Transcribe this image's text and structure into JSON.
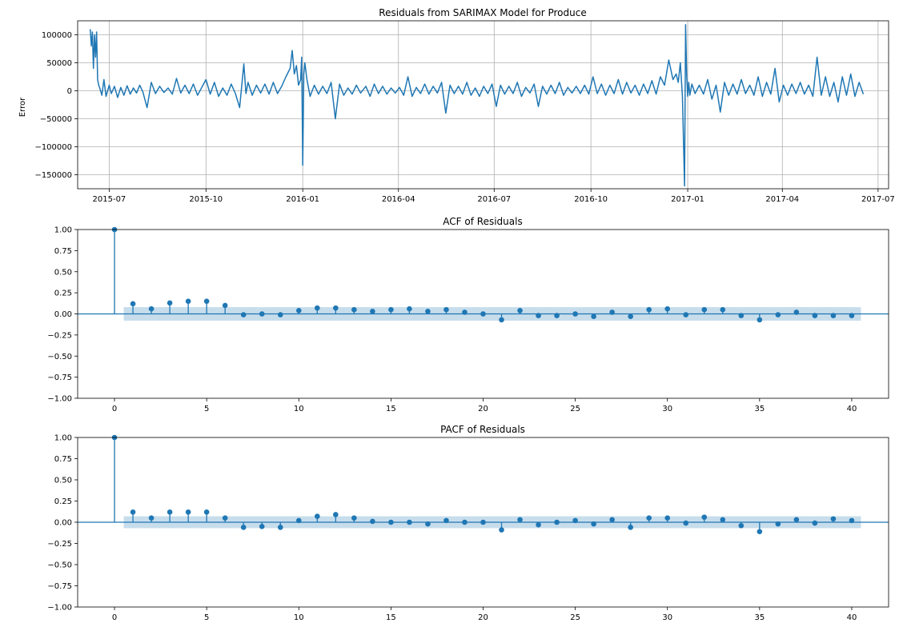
{
  "colors": {
    "line": "#1f77b4",
    "band": "#1f77b4",
    "grid": "#b0b0b0",
    "axis": "#000000"
  },
  "chart_data": [
    {
      "type": "line",
      "title": "Residuals from SARIMAX Model for Produce",
      "xlabel": "",
      "ylabel": "Error",
      "grid": true,
      "xlim": [
        "2015-06-01",
        "2017-07-11"
      ],
      "ylim": [
        -175000,
        125000
      ],
      "xtick_labels": [
        "2015-07",
        "2015-10",
        "2016-01",
        "2016-04",
        "2016-07",
        "2016-10",
        "2017-01",
        "2017-04",
        "2017-07"
      ],
      "xtick_dates": [
        "2015-07-01",
        "2015-10-01",
        "2016-01-01",
        "2016-04-01",
        "2016-07-01",
        "2016-10-01",
        "2017-01-01",
        "2017-04-01",
        "2017-07-01"
      ],
      "yticks": [
        -150000,
        -100000,
        -50000,
        0,
        50000,
        100000
      ],
      "ytick_labels": [
        "−150000",
        "−100000",
        "−50000",
        "0",
        "50000",
        "100000"
      ],
      "series": [
        {
          "dates": [
            "2015-06-13",
            "2015-06-14",
            "2015-06-15",
            "2015-06-16",
            "2015-06-17",
            "2015-06-18",
            "2015-06-19",
            "2015-06-20",
            "2015-06-21",
            "2015-06-22",
            "2015-06-24",
            "2015-06-26",
            "2015-06-28",
            "2015-07-01",
            "2015-07-03",
            "2015-07-06",
            "2015-07-09",
            "2015-07-12",
            "2015-07-15",
            "2015-07-18",
            "2015-07-21",
            "2015-07-24",
            "2015-07-27",
            "2015-07-30",
            "2015-08-02",
            "2015-08-06",
            "2015-08-10",
            "2015-08-14",
            "2015-08-18",
            "2015-08-22",
            "2015-08-26",
            "2015-08-30",
            "2015-09-03",
            "2015-09-07",
            "2015-09-11",
            "2015-09-15",
            "2015-09-19",
            "2015-09-23",
            "2015-09-27",
            "2015-10-01",
            "2015-10-05",
            "2015-10-09",
            "2015-10-13",
            "2015-10-17",
            "2015-10-21",
            "2015-10-25",
            "2015-10-29",
            "2015-11-02",
            "2015-11-06",
            "2015-11-08",
            "2015-11-10",
            "2015-11-14",
            "2015-11-18",
            "2015-11-22",
            "2015-11-26",
            "2015-11-30",
            "2015-12-04",
            "2015-12-08",
            "2015-12-12",
            "2015-12-16",
            "2015-12-20",
            "2015-12-22",
            "2015-12-24",
            "2015-12-26",
            "2015-12-28",
            "2015-12-30",
            "2015-12-31",
            "2016-01-01",
            "2016-01-02",
            "2016-01-03",
            "2016-01-05",
            "2016-01-08",
            "2016-01-12",
            "2016-01-16",
            "2016-01-20",
            "2016-01-24",
            "2016-01-28",
            "2016-02-01",
            "2016-02-05",
            "2016-02-09",
            "2016-02-13",
            "2016-02-17",
            "2016-02-21",
            "2016-02-25",
            "2016-03-01",
            "2016-03-05",
            "2016-03-09",
            "2016-03-13",
            "2016-03-17",
            "2016-03-21",
            "2016-03-25",
            "2016-03-29",
            "2016-04-02",
            "2016-04-06",
            "2016-04-10",
            "2016-04-14",
            "2016-04-18",
            "2016-04-22",
            "2016-04-26",
            "2016-04-30",
            "2016-05-04",
            "2016-05-08",
            "2016-05-12",
            "2016-05-16",
            "2016-05-20",
            "2016-05-24",
            "2016-05-28",
            "2016-06-01",
            "2016-06-05",
            "2016-06-09",
            "2016-06-13",
            "2016-06-17",
            "2016-06-21",
            "2016-06-25",
            "2016-06-29",
            "2016-07-03",
            "2016-07-07",
            "2016-07-11",
            "2016-07-15",
            "2016-07-19",
            "2016-07-23",
            "2016-07-27",
            "2016-07-31",
            "2016-08-04",
            "2016-08-08",
            "2016-08-12",
            "2016-08-16",
            "2016-08-20",
            "2016-08-24",
            "2016-08-28",
            "2016-09-01",
            "2016-09-05",
            "2016-09-09",
            "2016-09-13",
            "2016-09-17",
            "2016-09-21",
            "2016-09-25",
            "2016-09-29",
            "2016-10-03",
            "2016-10-07",
            "2016-10-11",
            "2016-10-15",
            "2016-10-19",
            "2016-10-23",
            "2016-10-27",
            "2016-10-31",
            "2016-11-04",
            "2016-11-08",
            "2016-11-12",
            "2016-11-16",
            "2016-11-20",
            "2016-11-24",
            "2016-11-28",
            "2016-12-02",
            "2016-12-06",
            "2016-12-10",
            "2016-12-14",
            "2016-12-18",
            "2016-12-21",
            "2016-12-23",
            "2016-12-25",
            "2016-12-27",
            "2016-12-29",
            "2016-12-30",
            "2016-12-31",
            "2017-01-01",
            "2017-01-02",
            "2017-01-03",
            "2017-01-05",
            "2017-01-08",
            "2017-01-12",
            "2017-01-16",
            "2017-01-20",
            "2017-01-24",
            "2017-01-28",
            "2017-02-01",
            "2017-02-05",
            "2017-02-09",
            "2017-02-13",
            "2017-02-17",
            "2017-02-21",
            "2017-02-25",
            "2017-03-01",
            "2017-03-05",
            "2017-03-09",
            "2017-03-13",
            "2017-03-17",
            "2017-03-21",
            "2017-03-25",
            "2017-03-29",
            "2017-04-02",
            "2017-04-06",
            "2017-04-10",
            "2017-04-14",
            "2017-04-18",
            "2017-04-22",
            "2017-04-26",
            "2017-04-30",
            "2017-05-04",
            "2017-05-08",
            "2017-05-12",
            "2017-05-16",
            "2017-05-20",
            "2017-05-24",
            "2017-05-28",
            "2017-06-01",
            "2017-06-05",
            "2017-06-09",
            "2017-06-13",
            "2017-06-17"
          ],
          "values": [
            110000,
            80000,
            105000,
            40000,
            100000,
            60000,
            105000,
            20000,
            10000,
            5000,
            -8000,
            20000,
            -10000,
            10000,
            -5000,
            8000,
            -12000,
            6000,
            -8000,
            9000,
            -6000,
            5000,
            -4000,
            10000,
            -2000,
            -30000,
            15000,
            -5000,
            8000,
            -3000,
            5000,
            -6000,
            22000,
            -4000,
            10000,
            -5000,
            12000,
            -8000,
            6000,
            20000,
            -6000,
            15000,
            -10000,
            5000,
            -8000,
            12000,
            -5000,
            -30000,
            48000,
            -5000,
            15000,
            -8000,
            10000,
            -4000,
            12000,
            -6000,
            15000,
            -5000,
            8000,
            25000,
            40000,
            72000,
            30000,
            45000,
            10000,
            20000,
            60000,
            -133000,
            30000,
            50000,
            20000,
            -10000,
            10000,
            -6000,
            8000,
            -5000,
            15000,
            -50000,
            12000,
            -8000,
            5000,
            -6000,
            10000,
            -4000,
            8000,
            -10000,
            12000,
            -5000,
            8000,
            -6000,
            5000,
            -4000,
            6000,
            -8000,
            25000,
            -10000,
            6000,
            -5000,
            12000,
            -6000,
            8000,
            -4000,
            15000,
            -40000,
            10000,
            -5000,
            8000,
            -6000,
            15000,
            -8000,
            5000,
            -10000,
            8000,
            -5000,
            12000,
            -28000,
            10000,
            -6000,
            8000,
            -5000,
            15000,
            -10000,
            6000,
            -4000,
            12000,
            -28000,
            8000,
            -6000,
            10000,
            -5000,
            15000,
            -8000,
            6000,
            -4000,
            8000,
            -5000,
            10000,
            -6000,
            25000,
            -5000,
            12000,
            -8000,
            10000,
            -5000,
            20000,
            -6000,
            15000,
            -4000,
            10000,
            -8000,
            12000,
            -5000,
            18000,
            -6000,
            25000,
            10000,
            55000,
            20000,
            30000,
            15000,
            50000,
            -10000,
            -170000,
            118000,
            30000,
            -10000,
            15000,
            -8000,
            12000,
            -5000,
            10000,
            -6000,
            20000,
            -15000,
            10000,
            -38000,
            15000,
            -8000,
            12000,
            -6000,
            20000,
            -5000,
            10000,
            -8000,
            25000,
            -10000,
            15000,
            -6000,
            40000,
            -20000,
            10000,
            -8000,
            12000,
            -5000,
            15000,
            -6000,
            10000,
            -10000,
            60000,
            -8000,
            25000,
            -10000,
            15000,
            -20000,
            25000,
            -8000,
            30000,
            -10000,
            15000,
            -6000,
            8000
          ]
        }
      ]
    },
    {
      "type": "stem",
      "title": "ACF of Residuals",
      "xlabel": "",
      "ylabel": "",
      "grid": false,
      "xlim": [
        -2,
        42
      ],
      "ylim": [
        -1,
        1
      ],
      "xticks": [
        0,
        5,
        10,
        15,
        20,
        25,
        30,
        35,
        40
      ],
      "yticks": [
        -1.0,
        -0.75,
        -0.5,
        -0.25,
        0.0,
        0.25,
        0.5,
        0.75,
        1.0
      ],
      "ytick_labels": [
        "−1.00",
        "−0.75",
        "−0.50",
        "−0.25",
        "0.00",
        "0.25",
        "0.50",
        "0.75",
        "1.00"
      ],
      "confidence_band": 0.08,
      "lags": [
        0,
        1,
        2,
        3,
        4,
        5,
        6,
        7,
        8,
        9,
        10,
        11,
        12,
        13,
        14,
        15,
        16,
        17,
        18,
        19,
        20,
        21,
        22,
        23,
        24,
        25,
        26,
        27,
        28,
        29,
        30,
        31,
        32,
        33,
        34,
        35,
        36,
        37,
        38,
        39,
        40
      ],
      "values": [
        1.0,
        0.12,
        0.06,
        0.13,
        0.15,
        0.15,
        0.1,
        -0.01,
        0.0,
        -0.01,
        0.04,
        0.07,
        0.07,
        0.05,
        0.03,
        0.05,
        0.06,
        0.03,
        0.05,
        0.02,
        0.0,
        -0.07,
        0.04,
        -0.02,
        -0.02,
        0.0,
        -0.03,
        0.02,
        -0.03,
        0.05,
        0.06,
        -0.01,
        0.05,
        0.05,
        -0.02,
        -0.07,
        -0.01,
        0.02,
        -0.02,
        -0.02,
        -0.02
      ]
    },
    {
      "type": "stem",
      "title": "PACF of Residuals",
      "xlabel": "",
      "ylabel": "",
      "grid": false,
      "xlim": [
        -2,
        42
      ],
      "ylim": [
        -1,
        1
      ],
      "xticks": [
        0,
        5,
        10,
        15,
        20,
        25,
        30,
        35,
        40
      ],
      "yticks": [
        -1.0,
        -0.75,
        -0.5,
        -0.25,
        0.0,
        0.25,
        0.5,
        0.75,
        1.0
      ],
      "ytick_labels": [
        "−1.00",
        "−0.75",
        "−0.50",
        "−0.25",
        "0.00",
        "0.25",
        "0.50",
        "0.75",
        "1.00"
      ],
      "confidence_band": 0.07,
      "lags": [
        0,
        1,
        2,
        3,
        4,
        5,
        6,
        7,
        8,
        9,
        10,
        11,
        12,
        13,
        14,
        15,
        16,
        17,
        18,
        19,
        20,
        21,
        22,
        23,
        24,
        25,
        26,
        27,
        28,
        29,
        30,
        31,
        32,
        33,
        34,
        35,
        36,
        37,
        38,
        39,
        40
      ],
      "values": [
        1.0,
        0.12,
        0.05,
        0.12,
        0.12,
        0.12,
        0.05,
        -0.06,
        -0.05,
        -0.06,
        0.02,
        0.07,
        0.09,
        0.05,
        0.01,
        0.0,
        0.0,
        -0.02,
        0.02,
        0.0,
        0.0,
        -0.09,
        0.03,
        -0.03,
        0.0,
        0.02,
        -0.02,
        0.03,
        -0.06,
        0.05,
        0.05,
        -0.01,
        0.06,
        0.03,
        -0.04,
        -0.11,
        -0.02,
        0.03,
        -0.01,
        0.04,
        0.02
      ]
    }
  ]
}
